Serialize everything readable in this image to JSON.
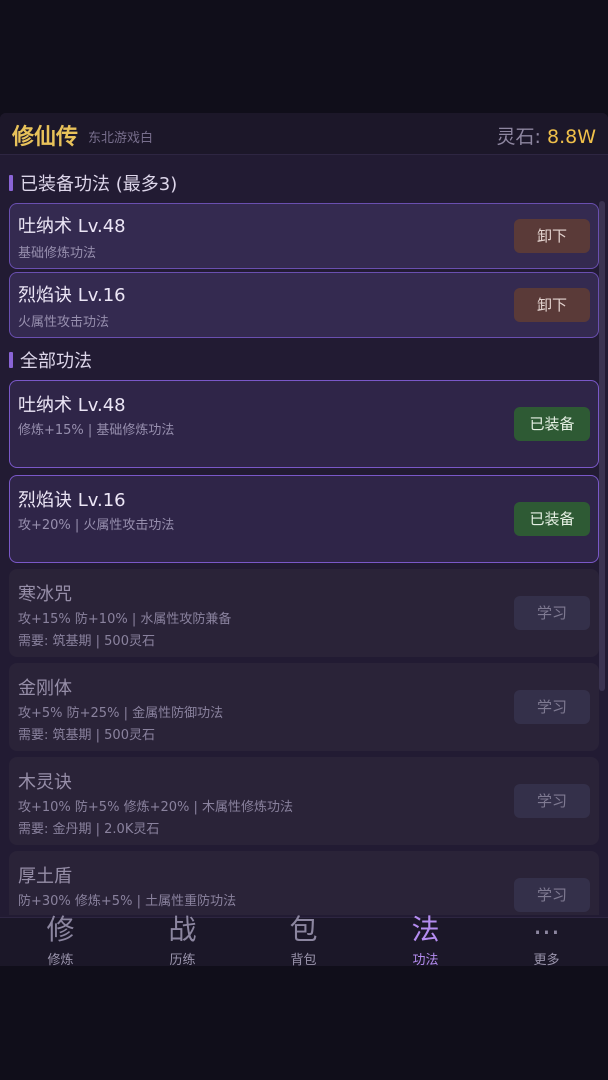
{
  "header": {
    "title": "修仙传",
    "subtitle": "东北游戏白",
    "currency_label": "灵石:",
    "currency_value": "8.8W"
  },
  "equipped_section": {
    "title": "已装备功法 (最多3)",
    "items": [
      {
        "name": "吐纳术 Lv.48",
        "desc": "基础修炼功法",
        "button": "卸下"
      },
      {
        "name": "烈焰诀 Lv.16",
        "desc": "火属性攻击功法",
        "button": "卸下"
      }
    ]
  },
  "all_section": {
    "title": "全部功法",
    "items": [
      {
        "name": "吐纳术 Lv.48",
        "desc": "修炼+15% | 基础修炼功法",
        "req": "",
        "button": "已装备",
        "state": "equipped"
      },
      {
        "name": "烈焰诀 Lv.16",
        "desc": "攻+20% | 火属性攻击功法",
        "req": "",
        "button": "已装备",
        "state": "equipped"
      },
      {
        "name": "寒冰咒",
        "desc": "攻+15% 防+10% | 水属性攻防兼备",
        "req": "需要: 筑基期 | 500灵石",
        "button": "学习",
        "state": "locked"
      },
      {
        "name": "金刚体",
        "desc": "攻+5% 防+25% | 金属性防御功法",
        "req": "需要: 筑基期 | 500灵石",
        "button": "学习",
        "state": "locked"
      },
      {
        "name": "木灵诀",
        "desc": "攻+10% 防+5% 修炼+20% | 木属性修炼功法",
        "req": "需要: 金丹期 | 2.0K灵石",
        "button": "学习",
        "state": "locked"
      },
      {
        "name": "厚土盾",
        "desc": "防+30% 修炼+5% | 土属性重防功法",
        "req": "",
        "button": "学习",
        "state": "locked"
      }
    ]
  },
  "nav": {
    "items": [
      {
        "glyph": "修",
        "label": "修炼"
      },
      {
        "glyph": "战",
        "label": "历练"
      },
      {
        "glyph": "包",
        "label": "背包"
      },
      {
        "glyph": "法",
        "label": "功法"
      },
      {
        "glyph": "...",
        "label": "更多"
      }
    ],
    "active_index": 3
  },
  "colors": {
    "accent": "#b48cf0",
    "gold": "#e8c25a",
    "equipped_green": "#2e5a34",
    "unequip_brown": "#5a3a38"
  }
}
